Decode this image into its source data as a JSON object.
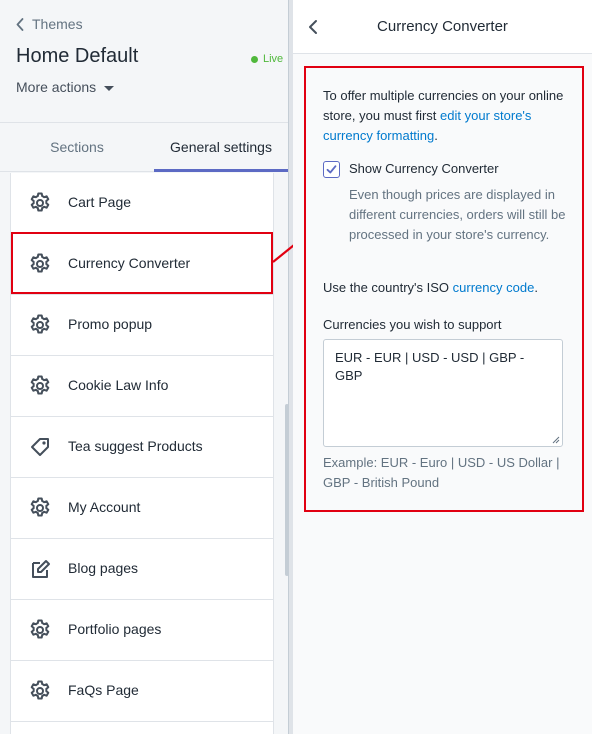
{
  "left": {
    "back_label": "Themes",
    "theme_title": "Home Default",
    "status": "Live",
    "more_actions": "More actions",
    "tabs": [
      {
        "label": "Sections"
      },
      {
        "label": "General settings"
      }
    ],
    "items": [
      {
        "label": "Cart Page",
        "icon": "gear-icon"
      },
      {
        "label": "Currency Converter",
        "icon": "gear-icon"
      },
      {
        "label": "Promo popup",
        "icon": "gear-icon"
      },
      {
        "label": "Cookie Law Info",
        "icon": "gear-icon"
      },
      {
        "label": "Tea suggest Products",
        "icon": "tag-icon"
      },
      {
        "label": "My Account",
        "icon": "gear-icon"
      },
      {
        "label": "Blog pages",
        "icon": "edit-icon"
      },
      {
        "label": "Portfolio pages",
        "icon": "gear-icon"
      },
      {
        "label": "FaQs Page",
        "icon": "gear-icon"
      }
    ]
  },
  "right": {
    "title": "Currency Converter",
    "intro_text": "To offer multiple currencies on your online store, you must first ",
    "intro_link": "edit your store's currency formatting",
    "intro_end": ".",
    "checkbox_label": "Show Currency Converter",
    "checkbox_checked": true,
    "help_text": "Even though prices are displayed in different currencies, orders will still be processed in your store's currency.",
    "iso_text": "Use the country's ISO ",
    "iso_link": "currency code",
    "iso_end": ".",
    "currencies_label": "Currencies you wish to support",
    "currencies_value": "EUR - EUR | USD - USD | GBP - GBP",
    "example_text": "Example: EUR - Euro | USD - US Dollar | GBP - British Pound"
  },
  "colors": {
    "accent": "#5c6ac4",
    "link": "#007ace",
    "live": "#50b83c",
    "highlight": "#e10011"
  }
}
